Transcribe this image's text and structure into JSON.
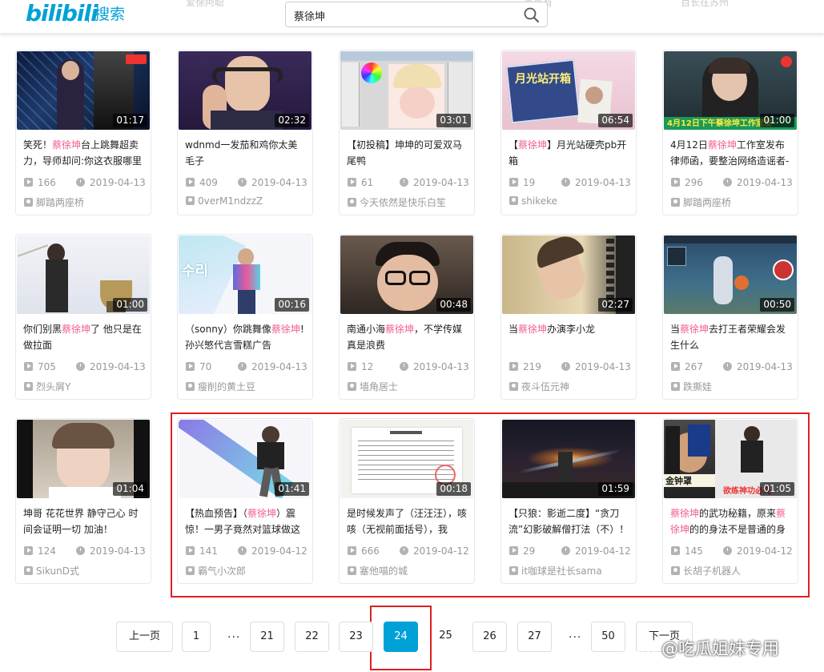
{
  "header": {
    "logo": "bilibili",
    "logo_sub": "搜索",
    "search_value": "蔡徐坤",
    "ghost_left": "爱徐阿聪",
    "ghost_mid": "一点点有",
    "ghost_right": "百长在苏州"
  },
  "cards": [
    {
      "duration": "01:17",
      "title_pre": "笑死！",
      "title_hl": "蔡徐坤",
      "title_post": "台上跳舞超卖力，导师却问:你这衣服哪里",
      "views": "166",
      "date": "2019-04-13",
      "uploader": "脚踏两座桥",
      "theme": "stage"
    },
    {
      "duration": "02:32",
      "title_pre": "wdnmd一发茄和鸡你太美毛子",
      "title_hl": "",
      "title_post": "",
      "views": "409",
      "date": "2019-04-13",
      "uploader": "0verM1ndzzZ",
      "theme": "gamer"
    },
    {
      "duration": "03:01",
      "title_pre": "【初投稿】坤坤的可爱双马尾鸭",
      "title_hl": "",
      "title_post": "",
      "views": "61",
      "date": "2019-04-13",
      "uploader": "今天依然是快乐白笙",
      "theme": "draw"
    },
    {
      "duration": "06:54",
      "title_pre": "【",
      "title_hl": "蔡徐坤",
      "title_post": "】月光站硬壳pb开箱",
      "views": "19",
      "date": "2019-04-13",
      "uploader": "shikeke",
      "theme": "unbox"
    },
    {
      "duration": "01:00",
      "title_pre": "4月12日",
      "title_hl": "蔡徐坤",
      "title_post": "工作室发布律师函，要整治网络造谣者-",
      "views": "296",
      "date": "2019-04-13",
      "uploader": "脚踏两座桥",
      "theme": "news"
    },
    {
      "duration": "01:00",
      "title_pre": "你们别黑",
      "title_hl": "蔡徐坤",
      "title_post": "了 他只是在做拉面",
      "views": "705",
      "date": "2019-04-13",
      "uploader": "烈头屑Y",
      "theme": "noodle"
    },
    {
      "duration": "00:16",
      "title_pre": "（sonny）你跳舞像",
      "title_hl": "蔡徐坤",
      "title_post": "! 孙兴慜代言雪糕广告",
      "views": "70",
      "date": "2019-04-13",
      "uploader": "瘦削的黄土豆",
      "theme": "ad"
    },
    {
      "duration": "00:48",
      "title_pre": "南通小海",
      "title_hl": "蔡徐坤",
      "title_post": "，不学传媒真是浪费",
      "views": "12",
      "date": "2019-04-13",
      "uploader": "墙角居士",
      "theme": "glasses"
    },
    {
      "duration": "02:27",
      "title_pre": "当",
      "title_hl": "蔡徐坤",
      "title_post": "办演李小龙",
      "views": "219",
      "date": "2019-04-13",
      "uploader": "夜斗伍元神",
      "theme": "lee"
    },
    {
      "duration": "00:50",
      "title_pre": "当",
      "title_hl": "蔡徐坤",
      "title_post": "去打王者荣耀会发生什么",
      "views": "267",
      "date": "2019-04-13",
      "uploader": "跌撕娃",
      "theme": "game"
    },
    {
      "duration": "01:04",
      "title_pre": "坤哥 花花世界 静守己心 时间会证明一切 加油！",
      "title_hl": "",
      "title_post": "",
      "views": "124",
      "date": "2019-04-13",
      "uploader": "SikunD式",
      "theme": "selfie"
    },
    {
      "duration": "01:41",
      "title_pre": "【热血预告】（",
      "title_hl": "蔡徐坤",
      "title_post": "）震惊！一男子竟然对篮球做这",
      "views": "141",
      "date": "2019-04-12",
      "uploader": "霸气小次郎",
      "theme": "ad2"
    },
    {
      "duration": "00:18",
      "title_pre": "是时候发声了（汪汪汪），咳咳（无视前面括号），我",
      "title_hl": "",
      "title_post": "",
      "views": "666",
      "date": "2019-04-12",
      "uploader": "塞他喵的城",
      "theme": "doc"
    },
    {
      "duration": "01:59",
      "title_pre": "【只狼：影逝二度】“贪刀流”幻影破解僧打法（不）！",
      "title_hl": "",
      "title_post": "",
      "views": "29",
      "date": "2019-04-12",
      "uploader": "it咖球是社长sama",
      "theme": "sekiro"
    },
    {
      "duration": "01:05",
      "title_pre": "",
      "title_hl": "蔡徐坤",
      "title_post": "的武功秘籍，原来",
      "title_hl2": "蔡徐坤",
      "title_post2": "的的身法不是普通的身",
      "views": "145",
      "date": "2019-04-12",
      "uploader": "长胡子机器人",
      "theme": "meme"
    }
  ],
  "pagination": {
    "prev": "上一页",
    "next": "下一页",
    "pages": [
      "1",
      "21",
      "22",
      "23",
      "24",
      "25",
      "26",
      "27",
      "50"
    ],
    "ellipsis": "...",
    "current": "24"
  },
  "watermark": "@吃瓜姐妹专用",
  "colors": {
    "accent": "#00a1d6",
    "highlight": "#f25d8e",
    "annotation": "#e02020"
  }
}
